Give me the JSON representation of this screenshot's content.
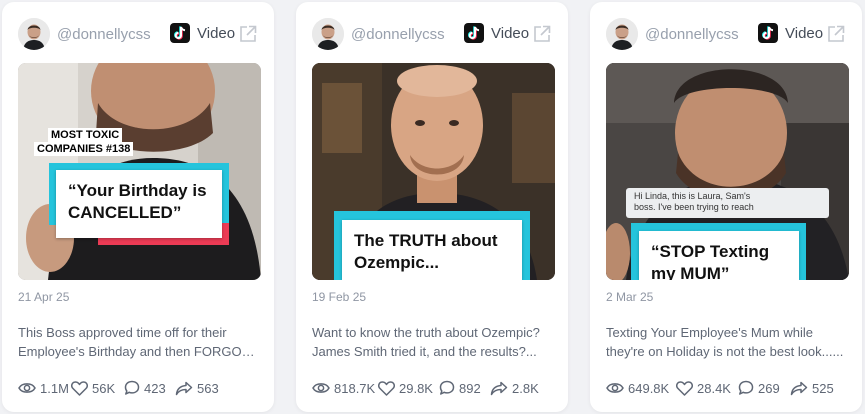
{
  "cards": [
    {
      "handle": "@donnellycss",
      "platform": "Video",
      "tag_line1": "MOST TOXIC",
      "tag_line2": "COMPANIES #138",
      "caption_line1": "“Your Birthday is",
      "caption_line2": "CANCELLED”",
      "date": "21 Apr 25",
      "desc_line1": "This Boss approved time off for their",
      "desc_line2": "Employee's Birthday and then FORGOT...",
      "views": "1.1M",
      "likes": "56K",
      "comments": "423",
      "shares": "563"
    },
    {
      "handle": "@donnellycss",
      "platform": "Video",
      "caption_line1": "The TRUTH about",
      "caption_line2": "Ozempic...",
      "date": "19 Feb 25",
      "desc_line1": "Want to know the truth about Ozempic?",
      "desc_line2": "James Smith tried it, and the results?...",
      "views": "818.7K",
      "likes": "29.8K",
      "comments": "892",
      "shares": "2.8K"
    },
    {
      "handle": "@donnellycss",
      "platform": "Video",
      "msg_line1": "Hi Linda, this is Laura, Sam's",
      "msg_line2": "boss. I've been trying to reach",
      "caption_line1": "“STOP Texting",
      "caption_line2": "my MUM”",
      "date": "2 Mar 25",
      "desc_line1": "Texting Your Employee's Mum while",
      "desc_line2": "they're on Holiday is not the best look......",
      "views": "649.8K",
      "likes": "28.4K",
      "comments": "269",
      "shares": "525"
    }
  ],
  "colors": {
    "accent_cyan": "#25c4dc",
    "accent_red": "#ec3b55",
    "icon_gray": "#5f6775"
  },
  "icons": {
    "views": "eye-icon",
    "likes": "heart-icon",
    "comments": "comment-icon",
    "shares": "share-icon",
    "platform": "tiktok-icon",
    "open": "external-link-icon"
  }
}
